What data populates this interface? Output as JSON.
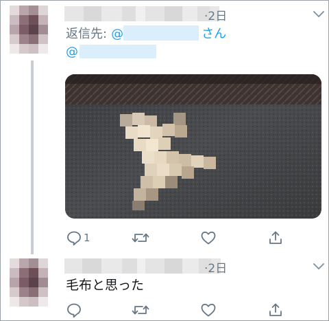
{
  "tweets": [
    {
      "time": "·2日",
      "reply_label": "返信先:",
      "reply_at": "@",
      "reply_suffix": "さん",
      "mention_at": "@",
      "actions": {
        "reply_count": "1"
      }
    },
    {
      "time": "·2日",
      "text": "毛布と思った"
    }
  ],
  "colors": {
    "accent": "#1da1f2",
    "muted": "#657786",
    "thread_line": "#c7cdd3"
  },
  "icons": [
    "reply-icon",
    "retweet-icon",
    "like-icon",
    "share-icon",
    "chevron-down-icon"
  ]
}
